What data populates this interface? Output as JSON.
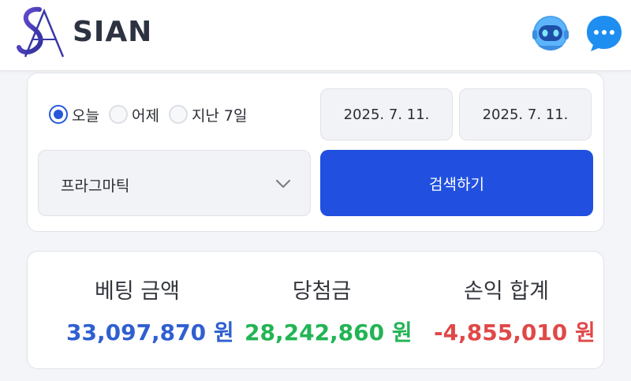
{
  "header": {
    "logo_text": "SIAN",
    "logo_icon": "sa-monogram-logo",
    "bot_icon": "robot-assistant-icon",
    "chat_icon": "chat-bubble-icon"
  },
  "filter": {
    "period_options": [
      {
        "label": "오늘",
        "selected": true
      },
      {
        "label": "어제",
        "selected": false
      },
      {
        "label": "지난 7일",
        "selected": false
      }
    ],
    "start_date": "2025. 7. 11.",
    "end_date": "2025. 7. 11.",
    "category_value": "프라그마틱",
    "search_label": "검색하기"
  },
  "summary": {
    "betting_title": "베팅 금액",
    "betting_value": "33,097,870 원",
    "win_title": "당첨금",
    "win_value": "28,242,860 원",
    "pl_title": "손익 합계",
    "pl_value": "-4,855,010 원"
  },
  "colors": {
    "accent": "#2150e0",
    "betting": "#2f5fd0",
    "win": "#22b455",
    "loss": "#e04848"
  }
}
